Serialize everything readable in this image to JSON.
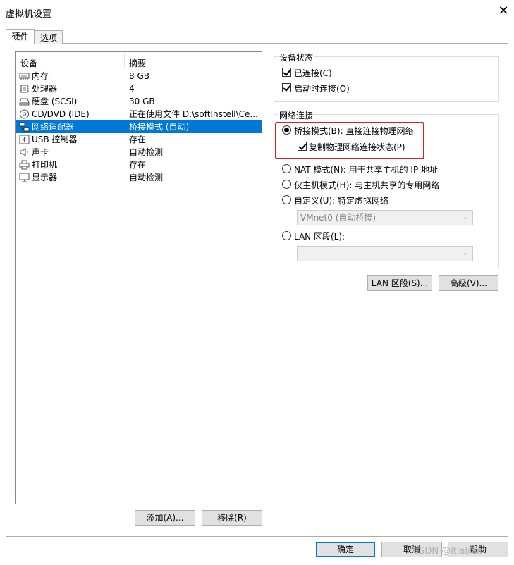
{
  "window": {
    "title": "虚拟机设置",
    "close_label": "✕"
  },
  "tabs": [
    {
      "label": "硬件"
    },
    {
      "label": "选项"
    }
  ],
  "device_list": {
    "headers": {
      "device": "设备",
      "summary": "摘要"
    },
    "rows": [
      {
        "name": "内存",
        "summary": "8 GB",
        "icon": "memory-icon"
      },
      {
        "name": "处理器",
        "summary": "4",
        "icon": "processor-icon"
      },
      {
        "name": "硬盘 (SCSI)",
        "summary": "30 GB",
        "icon": "hard-disk-icon"
      },
      {
        "name": "CD/DVD (IDE)",
        "summary": "正在使用文件 D:\\softInstell\\Ce...",
        "icon": "cd-dvd-icon"
      },
      {
        "name": "网络适配器",
        "summary": "桥接模式 (自动)",
        "icon": "network-adapter-icon",
        "selected": true
      },
      {
        "name": "USB 控制器",
        "summary": "存在",
        "icon": "usb-icon"
      },
      {
        "name": "声卡",
        "summary": "自动检测",
        "icon": "sound-card-icon"
      },
      {
        "name": "打印机",
        "summary": "存在",
        "icon": "printer-icon"
      },
      {
        "name": "显示器",
        "summary": "自动检测",
        "icon": "display-icon"
      }
    ],
    "add_button": "添加(A)...",
    "remove_button": "移除(R)"
  },
  "device_status": {
    "title": "设备状态",
    "connected": {
      "label": "已连接(C)",
      "checked": true
    },
    "connect_at_power_on": {
      "label": "启动时连接(O)",
      "checked": true
    }
  },
  "network": {
    "title": "网络连接",
    "bridged": {
      "label": "桥接模式(B): 直接连接物理网络",
      "selected": true
    },
    "replicate": {
      "label": "复制物理网络连接状态(P)",
      "checked": true
    },
    "nat": {
      "label": "NAT 模式(N): 用于共享主机的 IP 地址"
    },
    "host_only": {
      "label": "仅主机模式(H): 与主机共享的专用网络"
    },
    "custom": {
      "label": "自定义(U): 特定虚拟网络",
      "select_value": "VMnet0 (自动桥接)"
    },
    "lan_segment": {
      "label": "LAN 区段(L):",
      "select_value": ""
    },
    "lan_segments_button": "LAN 区段(S)...",
    "advanced_button": "高级(V)..."
  },
  "footer": {
    "ok": "确定",
    "cancel": "取消",
    "help": "帮助"
  },
  "watermark": "CSDN @ltlalrain",
  "colors": {
    "selection": "#0078d7",
    "highlight_border": "#e02020"
  }
}
